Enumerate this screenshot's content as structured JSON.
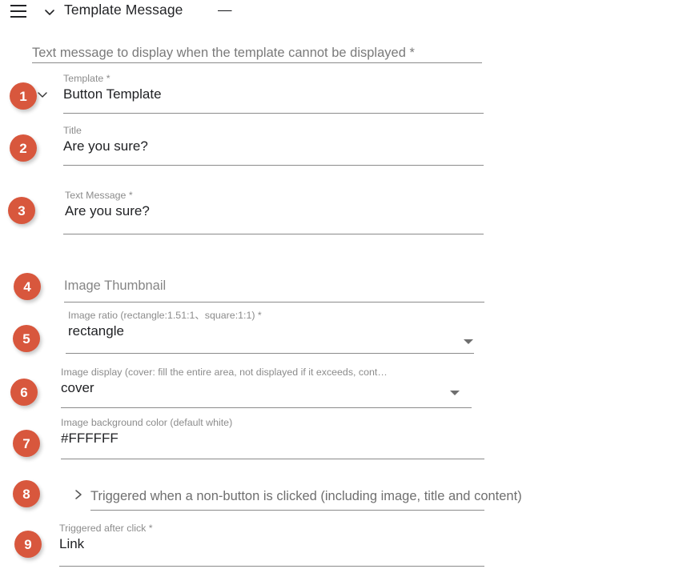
{
  "header": {
    "menu_icon": "hamburger-menu-icon",
    "collapse_icon": "chevron-down-icon",
    "title": "Template Message",
    "minimize": "—"
  },
  "top_field": {
    "label": "Text message to display when the template cannot be displayed *"
  },
  "fields": [
    {
      "badge": "1",
      "name": "template",
      "label": "Template *",
      "value": "Button Template",
      "has_inline_chevron": true,
      "icon": "chevron-down-icon"
    },
    {
      "badge": "2",
      "name": "title",
      "label": "Title",
      "value": "Are you sure?"
    },
    {
      "badge": "3",
      "name": "text-message",
      "label": "Text Message *",
      "value": "Are you sure?"
    },
    {
      "badge": "4",
      "name": "image-thumbnail",
      "label": "",
      "value": "Image Thumbnail",
      "is_placeholder": true
    },
    {
      "badge": "5",
      "name": "image-ratio",
      "label": "Image ratio (rectangle:1.51:1、square:1:1) *",
      "value": "rectangle",
      "has_caret": true,
      "icon": "dropdown-caret-icon"
    },
    {
      "badge": "6",
      "name": "image-display",
      "label": "Image display (cover: fill the entire area, not displayed if it exceeds, cont…",
      "value": "cover",
      "has_caret": true,
      "icon": "dropdown-caret-icon"
    },
    {
      "badge": "7",
      "name": "image-background-color",
      "label": "Image background color (default white)",
      "value": "#FFFFFF"
    },
    {
      "badge": "9",
      "name": "triggered-after-click",
      "label": "Triggered after click *",
      "value": "Link"
    }
  ],
  "collapsed_section": {
    "badge": "8",
    "icon": "chevron-right-icon",
    "label": "Triggered when a non-button is clicked (including image, title and content)"
  },
  "colors": {
    "badge_background": "#d8573d",
    "badge_text": "#ffffff",
    "label_text": "#8c8c8c",
    "value_text": "#1f2023",
    "rule": "#8b8b8b"
  }
}
